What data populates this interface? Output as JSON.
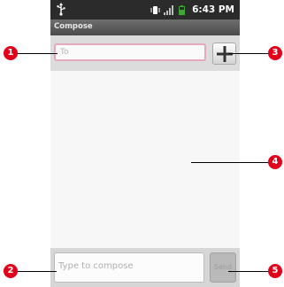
{
  "status_bar": {
    "time": "6:43 PM",
    "icons": [
      "usb-icon",
      "vibrate-icon",
      "signal-icon",
      "battery-icon"
    ]
  },
  "title_bar": {
    "title": "Compose"
  },
  "to_field": {
    "placeholder": "To"
  },
  "add_recipient_button": {
    "icon": "plus-icon"
  },
  "compose": {
    "placeholder": "Type to compose",
    "send_label": "Send"
  },
  "callouts": {
    "c1": "1",
    "c2": "2",
    "c3": "3",
    "c4": "4",
    "c5": "5"
  },
  "colors": {
    "callout_badge": "#e2001a",
    "to_field_border": "#e5a8bf",
    "status_bar": "#2b2b2b"
  }
}
